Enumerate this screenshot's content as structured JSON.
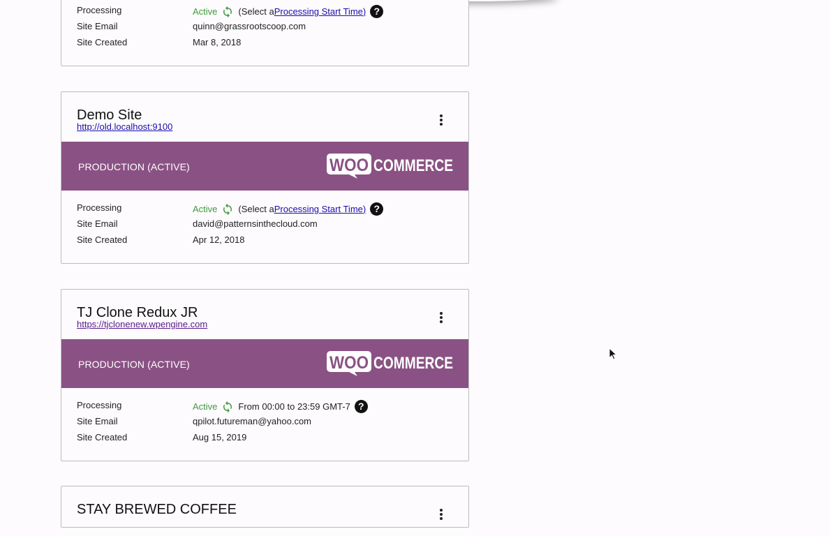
{
  "colors": {
    "banner": "#8a5284",
    "active_status": "#3d9b3b",
    "link": "#1a0dab",
    "help_icon": "#111111"
  },
  "cards": [
    {
      "name": "",
      "url": "",
      "environment": "",
      "processing_status": "Active",
      "processing_prefix": "(Select a ",
      "processing_link": "Processing Start Time",
      "processing_suffix": ")",
      "email": "quinn@grassrootscoop.com",
      "created": "Mar 8, 2018"
    },
    {
      "name": "Demo Site",
      "url": "http://old.localhost:9100",
      "environment": "PRODUCTION (ACTIVE)",
      "platform_logo": "woocommerce-logo",
      "logo_text_left": "WOO",
      "logo_text_right": "COMMERCE",
      "processing_status": "Active",
      "processing_prefix": "(Select a ",
      "processing_link": "Processing Start Time",
      "processing_suffix": ")",
      "email": "david@patternsinthecloud.com",
      "created": "Apr 12, 2018"
    },
    {
      "name": "TJ Clone Redux JR",
      "url": "https://tjclonenew.wpengine.com",
      "environment": "PRODUCTION (ACTIVE)",
      "platform_logo": "woocommerce-logo",
      "logo_text_left": "WOO",
      "logo_text_right": "COMMERCE",
      "processing_status": "Active",
      "processing_window": "From 00:00 to 23:59 GMT-7",
      "email": "qpilot.futureman@yahoo.com",
      "created": "Aug 15, 2019"
    },
    {
      "name": "STAY BREWED COFFEE"
    }
  ],
  "labels": {
    "processing": "Processing",
    "site_email": "Site Email",
    "site_created": "Site Created",
    "help": "?"
  },
  "icons": {
    "sync": "sync-icon",
    "help": "help-icon",
    "menu": "more-vertical-icon",
    "cursor": "mouse-pointer-icon"
  }
}
